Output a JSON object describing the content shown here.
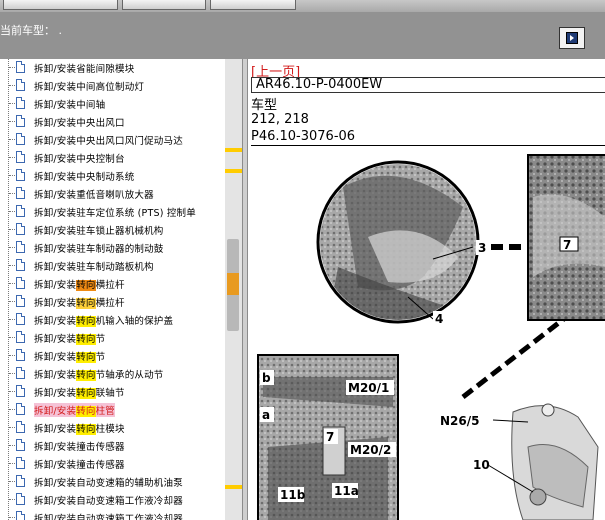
{
  "header": {
    "current_model": "当前车型： ."
  },
  "tree": {
    "items": [
      {
        "prefix": "拆卸/安装省能间隙模块",
        "hl": "",
        "suffix": "",
        "hl_class": "",
        "selected": false
      },
      {
        "prefix": "拆卸/安装中间高位制动灯",
        "hl": "",
        "suffix": "",
        "hl_class": "",
        "selected": false
      },
      {
        "prefix": "拆卸/安装中间轴",
        "hl": "",
        "suffix": "",
        "hl_class": "",
        "selected": false
      },
      {
        "prefix": "拆卸/安装中央出风口",
        "hl": "",
        "suffix": "",
        "hl_class": "",
        "selected": false
      },
      {
        "prefix": "拆卸/安装中央出风口风门促动马达",
        "hl": "",
        "suffix": "",
        "hl_class": "",
        "selected": false
      },
      {
        "prefix": "拆卸/安装中央控制台",
        "hl": "",
        "suffix": "",
        "hl_class": "",
        "selected": false
      },
      {
        "prefix": "拆卸/安装中央制动系统",
        "hl": "",
        "suffix": "",
        "hl_class": "",
        "selected": false
      },
      {
        "prefix": "拆卸/安装重低音喇叭放大器",
        "hl": "",
        "suffix": "",
        "hl_class": "",
        "selected": false
      },
      {
        "prefix": "拆卸/安装驻车定位系统 (PTS) 控制单",
        "hl": "",
        "suffix": "",
        "hl_class": "",
        "selected": false
      },
      {
        "prefix": "拆卸/安装驻车锁止器机械机构",
        "hl": "",
        "suffix": "",
        "hl_class": "",
        "selected": false
      },
      {
        "prefix": "拆卸/安装驻车制动器的制动鼓",
        "hl": "",
        "suffix": "",
        "hl_class": "",
        "selected": false
      },
      {
        "prefix": "拆卸/安装驻车制动踏板机构",
        "hl": "",
        "suffix": "",
        "hl_class": "",
        "selected": false
      },
      {
        "prefix": "拆卸/安装",
        "hl": "转向",
        "suffix": "横拉杆",
        "hl_class": "hl1",
        "selected": false
      },
      {
        "prefix": "拆卸/安装",
        "hl": "转向",
        "suffix": "横拉杆",
        "hl_class": "hl2",
        "selected": false
      },
      {
        "prefix": "拆卸/安装",
        "hl": "转向",
        "suffix": "机输入轴的保护盖",
        "hl_class": "hl3",
        "selected": false
      },
      {
        "prefix": "拆卸/安装",
        "hl": "转向",
        "suffix": "节",
        "hl_class": "hl3",
        "selected": false
      },
      {
        "prefix": "拆卸/安装",
        "hl": "转向",
        "suffix": "节",
        "hl_class": "hl3",
        "selected": false
      },
      {
        "prefix": "拆卸/安装",
        "hl": "转向",
        "suffix": "节轴承的从动节",
        "hl_class": "hl3",
        "selected": false
      },
      {
        "prefix": "拆卸/安装",
        "hl": "转向",
        "suffix": "联轴节",
        "hl_class": "hl3",
        "selected": false
      },
      {
        "prefix": "拆卸/安装",
        "hl": "转向",
        "suffix": "柱管",
        "hl_class": "hl3",
        "selected": true
      },
      {
        "prefix": "拆卸/安装",
        "hl": "转向",
        "suffix": "柱模块",
        "hl_class": "hl3",
        "selected": false
      },
      {
        "prefix": "拆卸/安装撞击传感器",
        "hl": "",
        "suffix": "",
        "hl_class": "",
        "selected": false
      },
      {
        "prefix": "拆卸/安装撞击传感器",
        "hl": "",
        "suffix": "",
        "hl_class": "",
        "selected": false
      },
      {
        "prefix": "拆卸/安装自动变速箱的辅助机油泵",
        "hl": "",
        "suffix": "",
        "hl_class": "",
        "selected": false
      },
      {
        "prefix": "拆卸/安装自动变速箱工作液冷却器",
        "hl": "",
        "suffix": "",
        "hl_class": "",
        "selected": false
      },
      {
        "prefix": "拆卸/安装自动变速箱工作液冷却器",
        "hl": "",
        "suffix": "",
        "hl_class": "",
        "selected": false
      }
    ]
  },
  "doc": {
    "prev_link": "[上一页]",
    "code": "AR46.10-P-0400EW",
    "model_label": "车型",
    "models": "212, 218",
    "figure_id": "P46.10-3076-06"
  },
  "figure": {
    "callouts": [
      "3",
      "4",
      "7",
      "b",
      "M20/1",
      "a",
      "7",
      "M20/2",
      "11b",
      "11a",
      "N26/5",
      "10"
    ]
  }
}
